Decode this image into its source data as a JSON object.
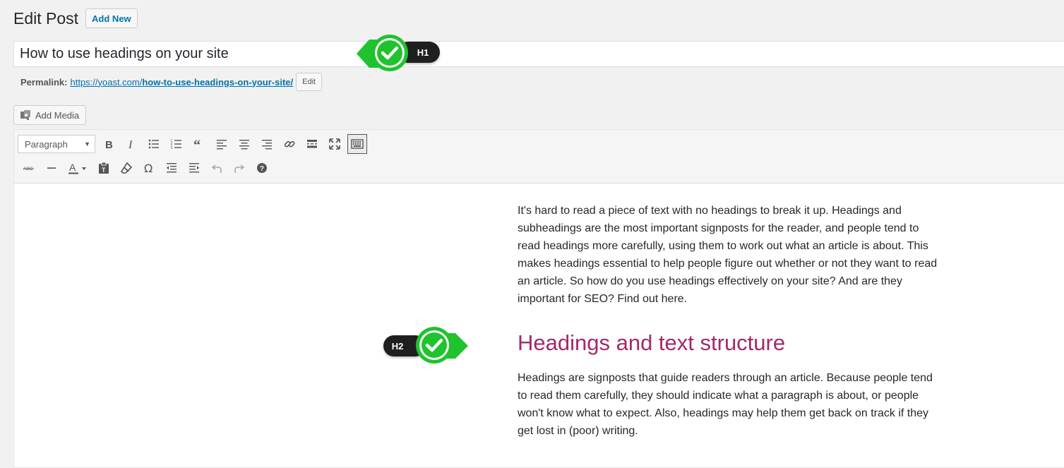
{
  "header": {
    "title": "Edit Post",
    "add_new_label": "Add New"
  },
  "post": {
    "title": "How to use headings on your site",
    "permalink_label": "Permalink:",
    "permalink_base": "https://yoast.com/",
    "permalink_slug": "how-to-use-headings-on-your-site/",
    "edit_slug_label": "Edit"
  },
  "media": {
    "add_media_label": "Add Media"
  },
  "toolbar": {
    "format_value": "Paragraph",
    "row1_icons": [
      "bold-icon",
      "italic-icon",
      "bulleted-list-icon",
      "numbered-list-icon",
      "blockquote-icon",
      "align-left-icon",
      "align-center-icon",
      "align-right-icon",
      "link-icon",
      "read-more-icon",
      "fullscreen-icon",
      "toolbar-toggle-icon"
    ],
    "row2_icons": [
      "strikethrough-icon",
      "horizontal-line-icon",
      "text-color-icon",
      "paste-as-text-icon",
      "clear-formatting-icon",
      "special-character-icon",
      "outdent-icon",
      "indent-icon",
      "undo-icon",
      "redo-icon",
      "help-icon"
    ]
  },
  "content": {
    "paragraph1": "It's hard to read a piece of text with no headings to break it up. Headings and subheadings are the most important signposts for the reader, and people tend to read headings more carefully, using them to work out what an article is about. This makes headings essential to help people figure out whether or not they want to read an article. So how do you use headings effectively on your site? And are they important for SEO? Find out here.",
    "heading2": "Headings and text structure",
    "paragraph2": "Headings are signposts that guide readers through an article. Because people tend to read them carefully, they should indicate what a paragraph is about, or people won't know what to expect. Also, headings may help them get back on track if they get lost in (poor) writing."
  },
  "badges": {
    "h1_label": "H1",
    "h2_label": "H2"
  },
  "colors": {
    "accent_link": "#0073aa",
    "heading_color": "#a4286a",
    "badge_green": "#1fc32d",
    "badge_dark": "#1f1f1f"
  }
}
